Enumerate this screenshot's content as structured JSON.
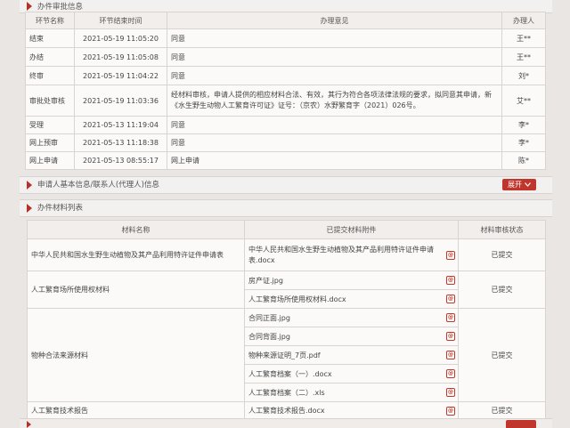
{
  "approval": {
    "title": "办件审批信息",
    "headers": [
      "环节名称",
      "环节结束时间",
      "办理意见",
      "办理人"
    ],
    "rows": [
      {
        "step": "结束",
        "time": "2021-05-19 11:05:20",
        "opinion": "同意",
        "handler": "王**"
      },
      {
        "step": "办结",
        "time": "2021-05-19 11:05:08",
        "opinion": "同意",
        "handler": "王**"
      },
      {
        "step": "终审",
        "time": "2021-05-19 11:04:22",
        "opinion": "同意",
        "handler": "刘*"
      },
      {
        "step": "审批处审核",
        "time": "2021-05-19 11:03:36",
        "opinion": "经材料审核，申请人提供的相应材料合法、有效，其行为符合各项法律法规的要求，拟同意其申请，新《水生野生动物人工繁育许可证》证号：（京农）水野繁育字（2021）026号。",
        "handler": "艾**"
      },
      {
        "step": "受理",
        "time": "2021-05-13 11:19:04",
        "opinion": "同意",
        "handler": "李*"
      },
      {
        "step": "网上预审",
        "time": "2021-05-13 11:18:38",
        "opinion": "同意",
        "handler": "李*"
      },
      {
        "step": "网上申请",
        "time": "2021-05-13 08:55:17",
        "opinion": "网上申请",
        "handler": "陈*"
      }
    ]
  },
  "applicant": {
    "title": "申请人基本信息/联系人(代理人)信息",
    "expand_label": "展开"
  },
  "materials": {
    "title": "办件材料列表",
    "headers": [
      "材料名称",
      "已提交材料附件",
      "材料审核状态"
    ],
    "groups": [
      {
        "name": "中华人民共和国水生野生动植物及其产品利用特许证件申请表",
        "files": [
          "中华人民共和国水生野生动植物及其产品利用特许证件申请表.docx"
        ],
        "status": "已提交"
      },
      {
        "name": "人工繁育场所使用权材料",
        "files": [
          "房产证.jpg",
          "人工繁育场所使用权材料.docx"
        ],
        "status": "已提交"
      },
      {
        "name": "物种合法来源材料",
        "files": [
          "合同正面.jpg",
          "合同背面.jpg",
          "物种来源证明_7页.pdf",
          "人工繁育档案（一）.docx",
          "人工繁育档案（二）.xls"
        ],
        "status": "已提交"
      },
      {
        "name": "人工繁育技术报告",
        "files": [
          "人工繁育技术报告.docx"
        ],
        "status": "已提交"
      }
    ]
  },
  "colors": {
    "accent": "#c0362c",
    "header_bg": "#f1eeec",
    "border": "#d9d4d0"
  },
  "icons": {
    "section_marker": "triangle-right-icon",
    "attachment": "attachment-icon",
    "expand": "chevron-down-icon"
  }
}
